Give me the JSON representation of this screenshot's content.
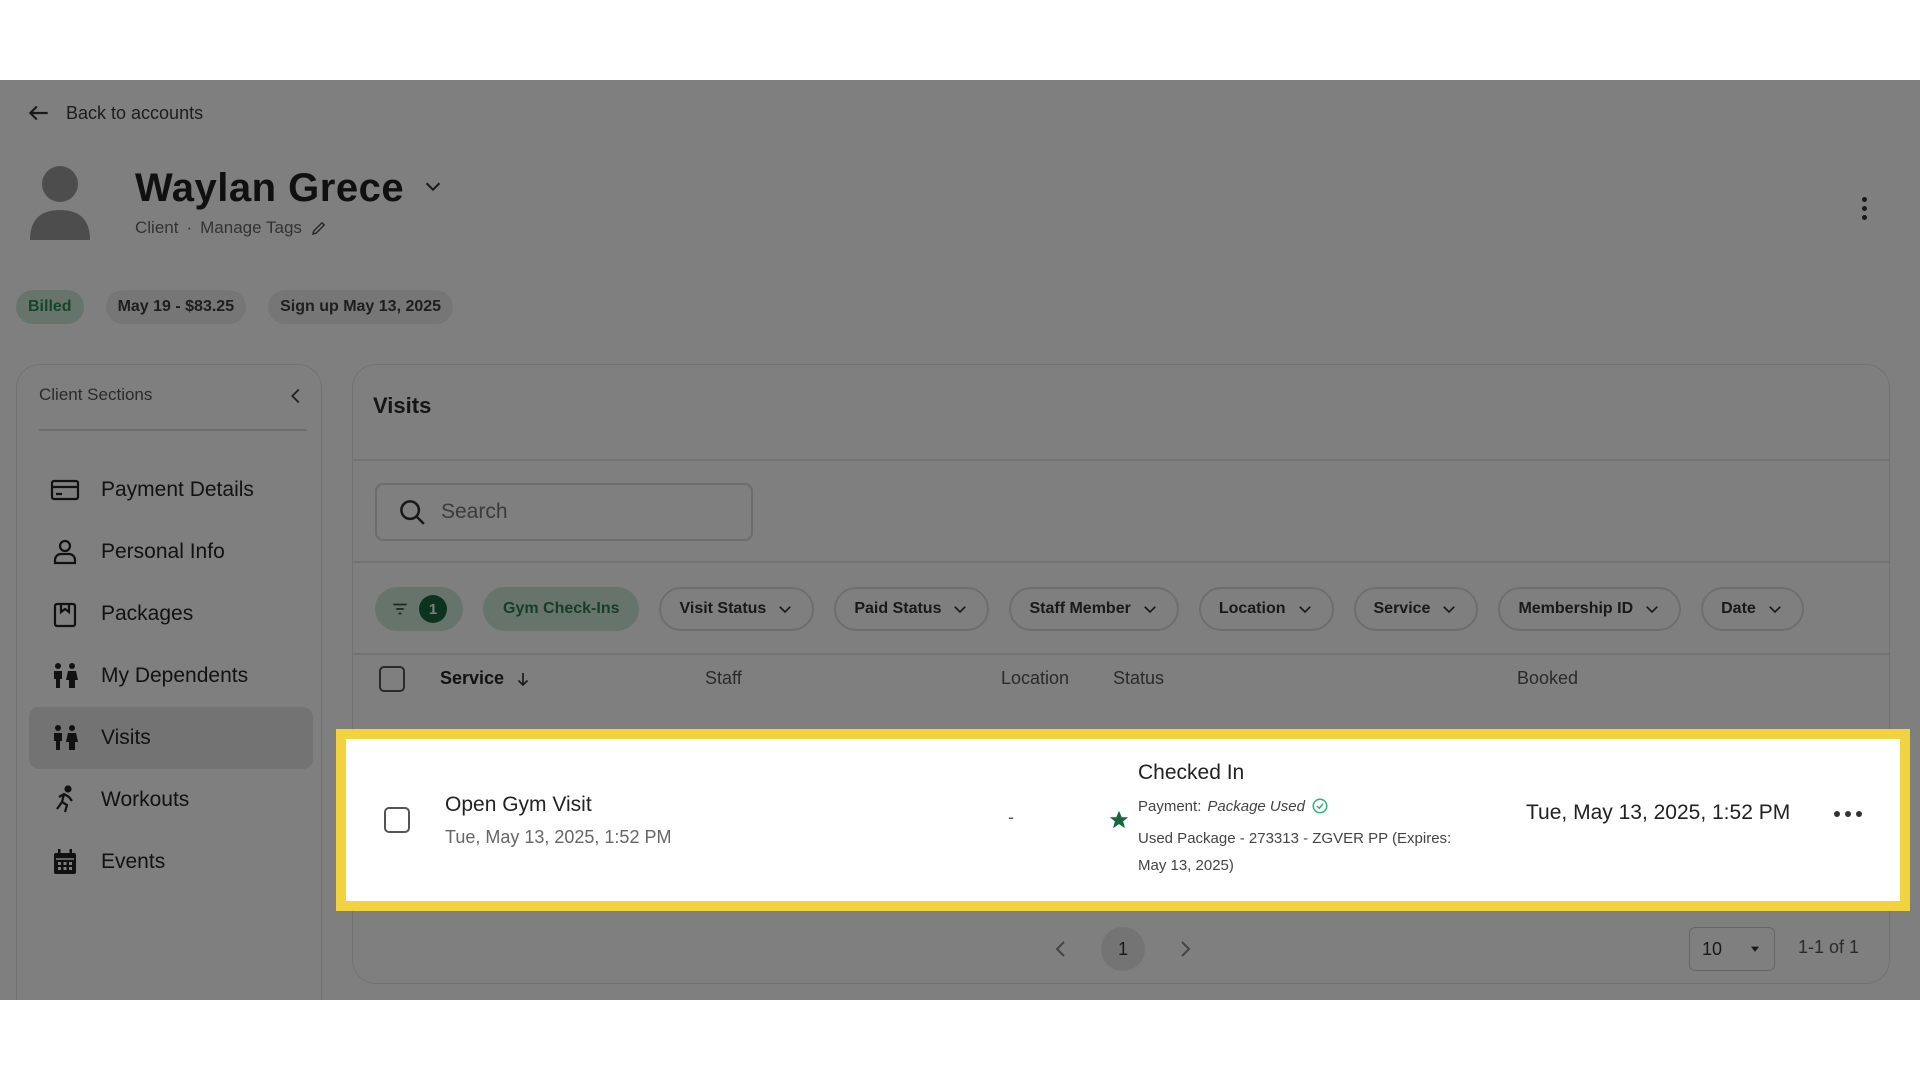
{
  "header": {
    "back_label": "Back to accounts",
    "client_name": "Waylan Grece",
    "role": "Client",
    "separator": "·",
    "manage_tags": "Manage Tags"
  },
  "badges": [
    {
      "label": "Billed",
      "color": "#2f8a55"
    },
    {
      "label": "May 19 - $83.25"
    },
    {
      "label": "Sign up May 13, 2025"
    }
  ],
  "sidebar": {
    "title": "Client Sections",
    "items": [
      {
        "label": "Payment Details",
        "icon": "credit-card-icon"
      },
      {
        "label": "Personal Info",
        "icon": "person-icon"
      },
      {
        "label": "Packages",
        "icon": "package-icon"
      },
      {
        "label": "My Dependents",
        "icon": "family-icon"
      },
      {
        "label": "Visits",
        "icon": "visits-icon",
        "active": true
      },
      {
        "label": "Workouts",
        "icon": "running-icon"
      },
      {
        "label": "Events",
        "icon": "calendar-icon"
      }
    ]
  },
  "main": {
    "title": "Visits",
    "search_placeholder": "Search",
    "filter_count": "1",
    "filters": [
      "Gym Check-Ins",
      "Visit Status",
      "Paid Status",
      "Staff Member",
      "Location",
      "Service",
      "Membership ID",
      "Date"
    ],
    "columns": {
      "service": "Service",
      "staff": "Staff",
      "location": "Location",
      "status": "Status",
      "booked": "Booked"
    },
    "rows": [
      {
        "service": "Open Gym Visit",
        "service_date": "Tue, May 13, 2025, 1:52 PM",
        "location": "-",
        "status": "Checked In",
        "payment_label": "Payment:",
        "payment_value": "Package Used",
        "package_info": "Used Package - 273313 - ZGVER PP (Expires: May 13, 2025)",
        "booked": "Tue, May 13, 2025, 1:52 PM"
      }
    ],
    "pagination": {
      "current_page": "1",
      "per_page": "10",
      "range": "1-1 of 1"
    }
  },
  "colors": {
    "accent_green": "#17663c",
    "chip_green_bg": "#cfe9d9",
    "highlight_yellow": "#f2d23e"
  }
}
